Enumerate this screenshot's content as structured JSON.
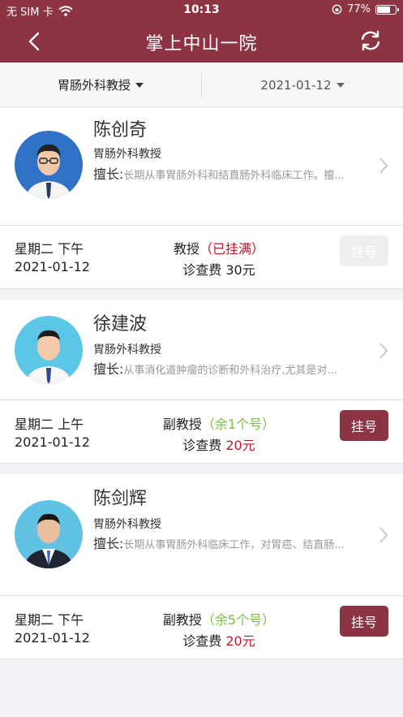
{
  "status_bar": {
    "carrier": "无 SIM 卡",
    "time": "10:13",
    "battery": "77%",
    "battery_level": 0.77
  },
  "nav": {
    "title": "掌上中山一院"
  },
  "filter": {
    "department": "胃肠外科教授",
    "date": "2021-01-12"
  },
  "doctors": [
    {
      "name": "陈创奇",
      "title": "胃肠外科教授",
      "specialty_label": "擅长:",
      "specialty_text": "长期从事胃肠外科和结直肠外科临床工作。擅...",
      "day": "星期二 下午",
      "date": "2021-01-12",
      "level": "教授",
      "availability": "（已挂满）",
      "fee_label": "诊查费",
      "fee": "30元",
      "button": "挂号",
      "button_enabled": false
    },
    {
      "name": "徐建波",
      "title": "胃肠外科教授",
      "specialty_label": "擅长:",
      "specialty_text": "从事消化道肿瘤的诊断和外科治疗,尤其是对...",
      "day": "星期二 上午",
      "date": "2021-01-12",
      "level": "副教授",
      "availability": "（余1个号）",
      "fee_label": "诊查费",
      "fee": "20元",
      "button": "挂号",
      "button_enabled": true
    },
    {
      "name": "陈剑辉",
      "title": "胃肠外科教授",
      "specialty_label": "擅长:",
      "specialty_text": "长期从事胃肠外科临床工作，对胃癌、结直肠...",
      "day": "星期二 下午",
      "date": "2021-01-12",
      "level": "副教授",
      "availability": "（余5个号）",
      "fee_label": "诊查费",
      "fee": "20元",
      "button": "挂号",
      "button_enabled": true
    }
  ],
  "colors": {
    "brand": "#8c3444",
    "full": "#c0182c",
    "available": "#7ac143"
  }
}
